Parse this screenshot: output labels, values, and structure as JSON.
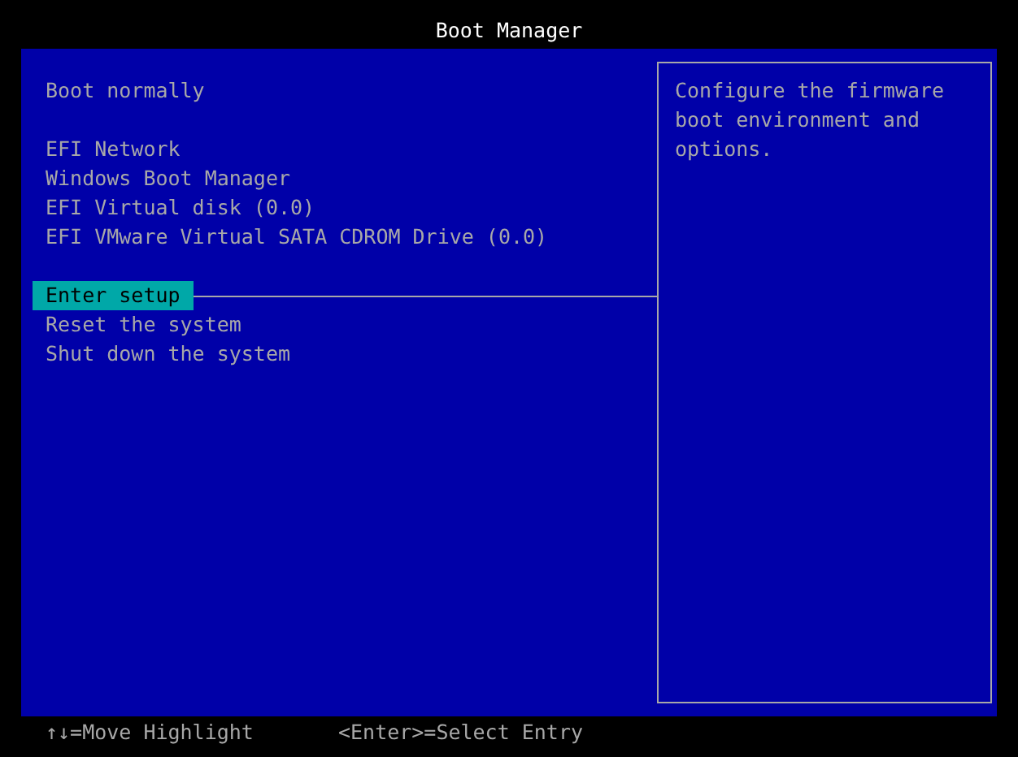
{
  "window": {
    "title": "Boot Manager"
  },
  "menu_groups": [
    {
      "items": [
        {
          "label": "Boot normally",
          "selected": false
        }
      ]
    },
    {
      "items": [
        {
          "label": "EFI Network",
          "selected": false
        },
        {
          "label": "Windows Boot Manager",
          "selected": false
        },
        {
          "label": "EFI Virtual disk (0.0)",
          "selected": false
        },
        {
          "label": "EFI VMware Virtual SATA CDROM Drive (0.0)",
          "selected": false
        }
      ]
    },
    {
      "items": [
        {
          "label": "Enter setup",
          "selected": true
        },
        {
          "label": "Reset the system",
          "selected": false
        },
        {
          "label": "Shut down the system",
          "selected": false
        }
      ]
    }
  ],
  "help_text": "Configure the firmware boot environment and options.",
  "status_bar": [
    "↑↓=Move Highlight",
    "<Enter>=Select Entry"
  ]
}
